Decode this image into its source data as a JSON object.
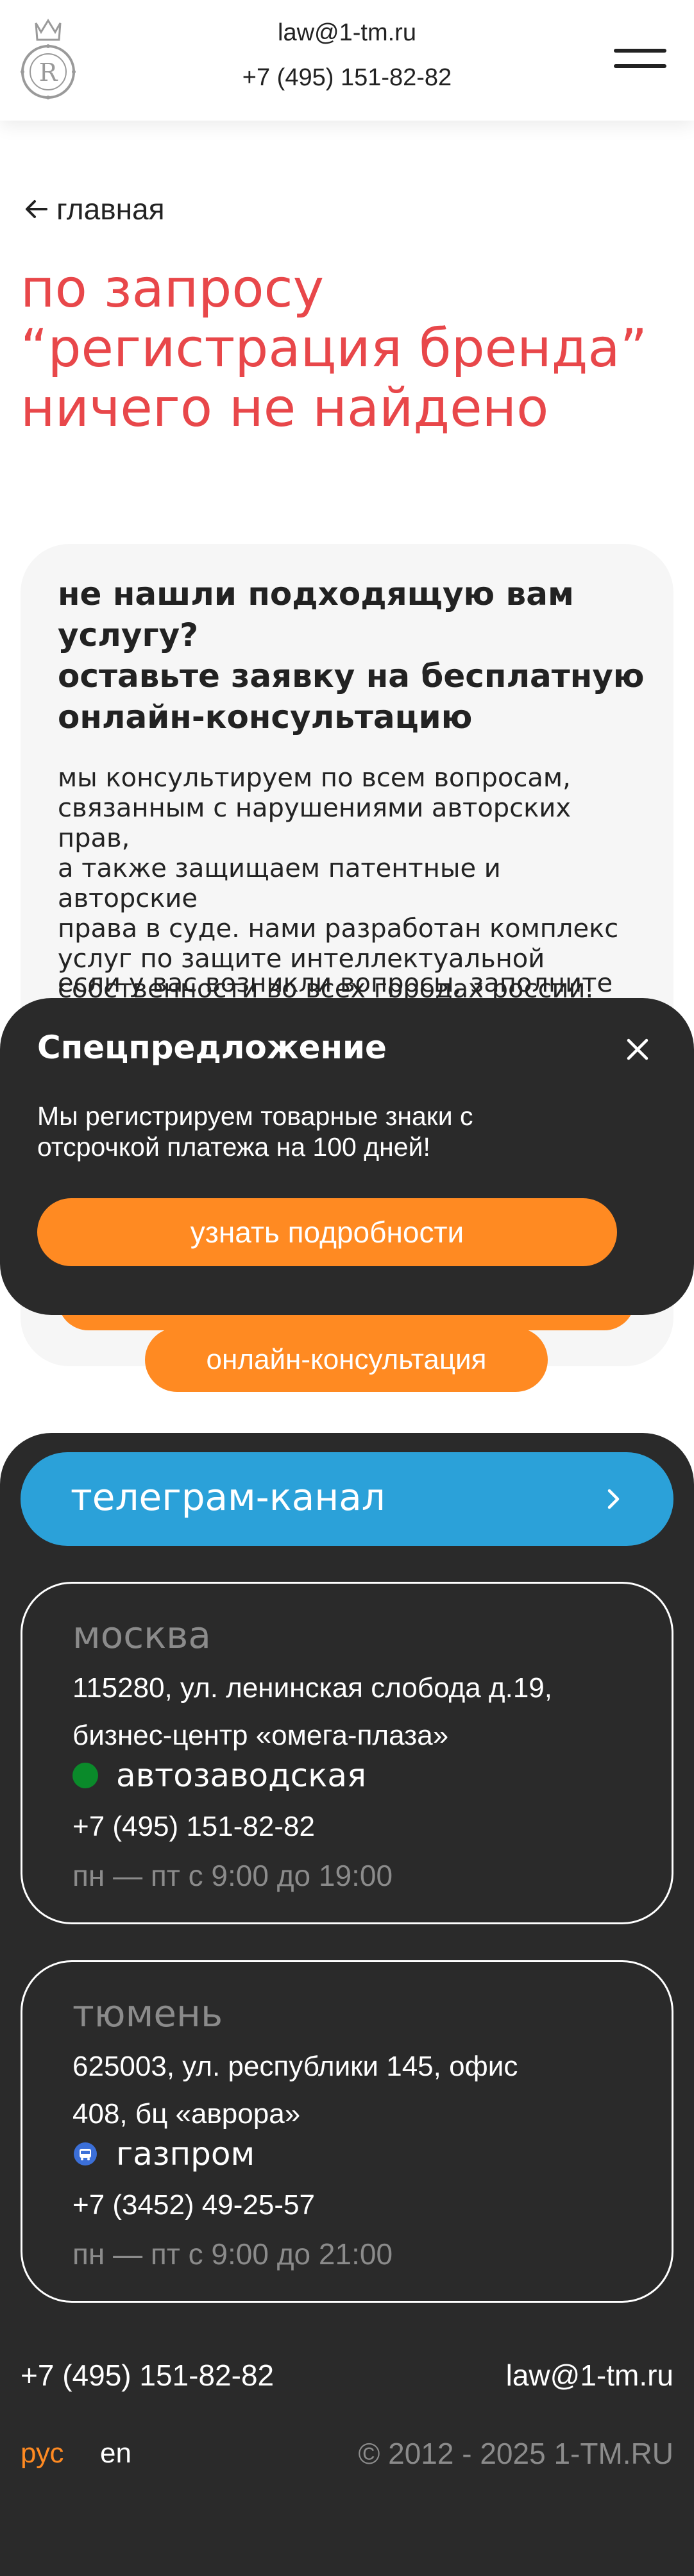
{
  "header": {
    "logo_icon": "crown-r-logo-icon",
    "email": "law@1-tm.ru",
    "phone": "+7 (495) 151-82-82",
    "menu_icon": "hamburger-menu-icon"
  },
  "back_link": {
    "icon": "arrow-left-icon",
    "label": "главная"
  },
  "search_result": {
    "title_lines": [
      "по запросу",
      "“регистрация бренда”",
      "ничего не найдено"
    ]
  },
  "consultation": {
    "heading_lines": [
      "не нашли подходящую вам",
      "услугу?",
      "оставьте заявку на бесплатную",
      "онлайн-консультацию"
    ],
    "text_lines": [
      "мы консультируем по всем вопросам,",
      "связанным с нарушениями авторских прав,",
      "а также защищаем патентные и авторские",
      "права в суде. нами разработан комплекс",
      "услуг по защите интеллектуальной",
      "собственности во всех городах россии."
    ],
    "text2": "если у вас возникли вопросы, заполните",
    "button_label": "онлайн-консультация"
  },
  "popup": {
    "title": "Спецпредложение",
    "close_icon": "close-icon",
    "text_lines": [
      "Мы регистрируем товарные знаки с",
      "отсрочкой платежа на 100 дней!"
    ],
    "button_label": "узнать подробности"
  },
  "footer": {
    "telegram": {
      "label": "телеграм-канал",
      "icon": "chevron-right-icon",
      "color": "#2ba1d9"
    },
    "offices": [
      {
        "city": "москва",
        "address_lines": [
          "115280, ул. ленинская слобода д.19,",
          "бизнес-центр «омега-плаза»"
        ],
        "metro": "автозаводская",
        "metro_icon": "metro-green-dot-icon",
        "metro_color": "#0a8a2a",
        "phone": "+7 (495) 151-82-82",
        "hours": "пн — пт с 9:00 до 19:00"
      },
      {
        "city": "тюмень",
        "address_lines": [
          "625003, ул. республики 145, офис",
          "408, бц «аврора»"
        ],
        "metro": "газпром",
        "metro_icon": "bus-stop-icon",
        "metro_color": "#3b6fd8",
        "phone": "+7 (3452) 49-25-57",
        "hours": "пн — пт с 9:00 до 21:00"
      }
    ],
    "phone": "+7 (495) 151-82-82",
    "email": "law@1-tm.ru",
    "languages": {
      "ru": "рус",
      "en": "en"
    },
    "copyright": "© 2012 - 2025 1-TM.RU"
  },
  "colors": {
    "accent_red": "#e8474a",
    "accent_orange": "#ff8a22",
    "dark_bg": "#2a2a2a",
    "telegram_blue": "#2ba1d9"
  }
}
